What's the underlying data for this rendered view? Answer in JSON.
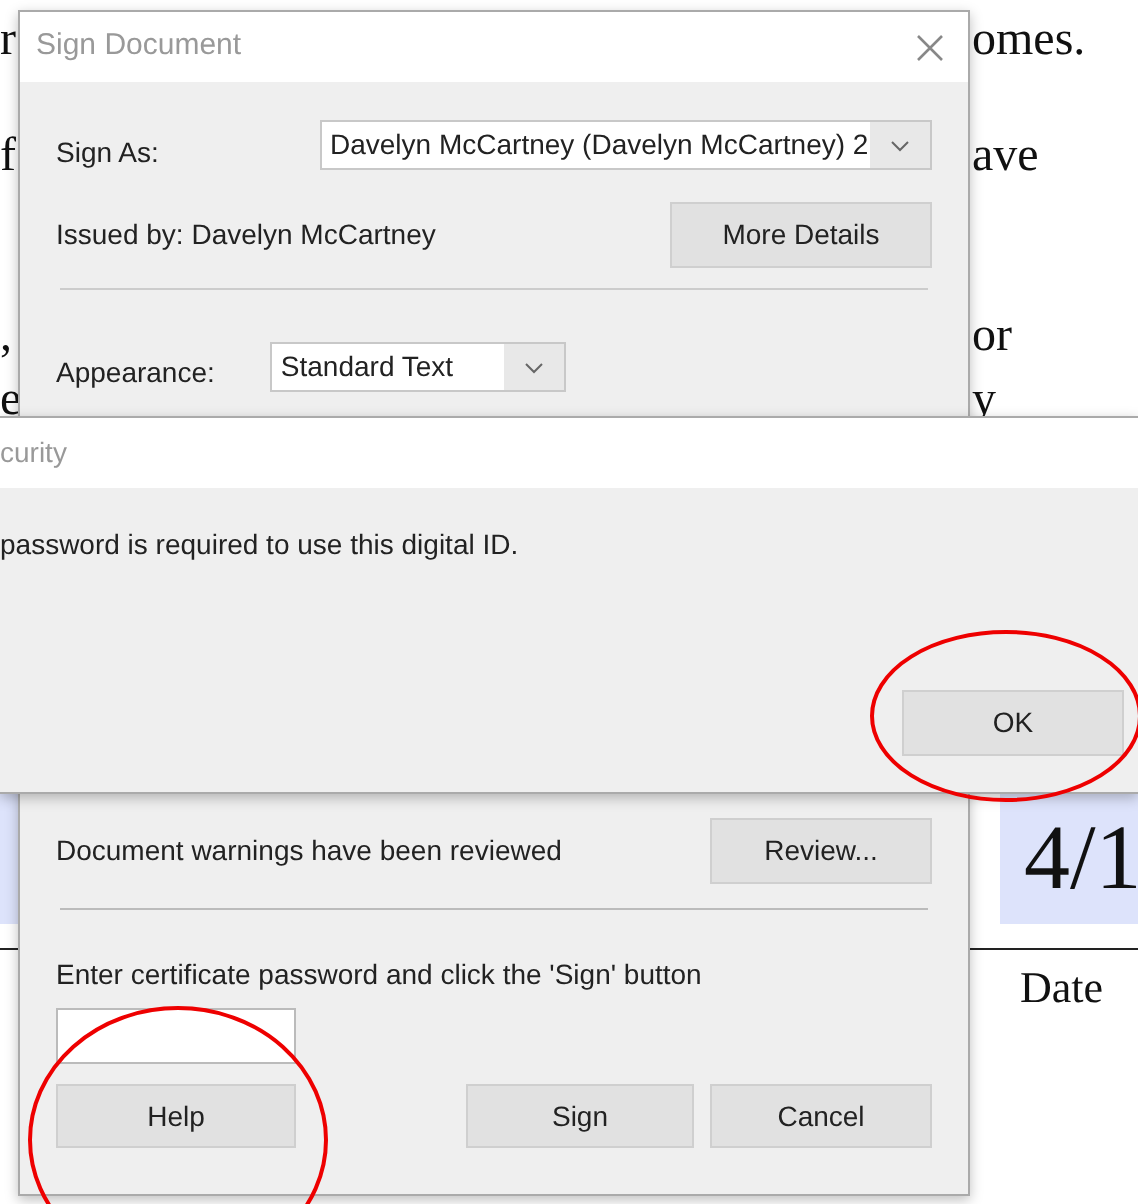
{
  "document": {
    "fragments": [
      "r",
      "omes.",
      "f",
      "ave",
      ",",
      "or",
      "e",
      "y"
    ],
    "cells": [
      "4/1"
    ],
    "date_label": "Date"
  },
  "sign_dialog": {
    "title": "Sign Document",
    "sign_as": {
      "label": "Sign As:",
      "value": "Davelyn McCartney (Davelyn McCartney) 2"
    },
    "issued_by": "Issued by: Davelyn McCartney",
    "more_details": "More Details",
    "appearance": {
      "label": "Appearance:",
      "value": "Standard Text"
    },
    "warnings": "Document warnings have been reviewed",
    "review": "Review...",
    "password_prompt": "Enter certificate password and click the 'Sign' button",
    "buttons": [
      "Help",
      "Sign",
      "Cancel"
    ]
  },
  "security_dialog": {
    "title": "curity",
    "message": "password is required to use this digital ID.",
    "button": "OK"
  }
}
